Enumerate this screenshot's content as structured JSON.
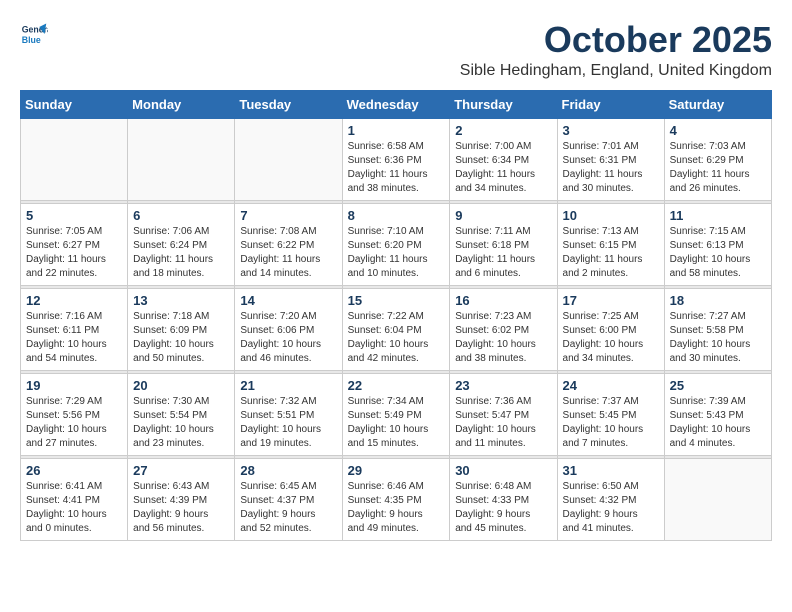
{
  "header": {
    "logo_line1": "General",
    "logo_line2": "Blue",
    "month_title": "October 2025",
    "location": "Sible Hedingham, England, United Kingdom"
  },
  "days_of_week": [
    "Sunday",
    "Monday",
    "Tuesday",
    "Wednesday",
    "Thursday",
    "Friday",
    "Saturday"
  ],
  "weeks": [
    [
      {
        "day": "",
        "info": ""
      },
      {
        "day": "",
        "info": ""
      },
      {
        "day": "",
        "info": ""
      },
      {
        "day": "1",
        "info": "Sunrise: 6:58 AM\nSunset: 6:36 PM\nDaylight: 11 hours\nand 38 minutes."
      },
      {
        "day": "2",
        "info": "Sunrise: 7:00 AM\nSunset: 6:34 PM\nDaylight: 11 hours\nand 34 minutes."
      },
      {
        "day": "3",
        "info": "Sunrise: 7:01 AM\nSunset: 6:31 PM\nDaylight: 11 hours\nand 30 minutes."
      },
      {
        "day": "4",
        "info": "Sunrise: 7:03 AM\nSunset: 6:29 PM\nDaylight: 11 hours\nand 26 minutes."
      }
    ],
    [
      {
        "day": "5",
        "info": "Sunrise: 7:05 AM\nSunset: 6:27 PM\nDaylight: 11 hours\nand 22 minutes."
      },
      {
        "day": "6",
        "info": "Sunrise: 7:06 AM\nSunset: 6:24 PM\nDaylight: 11 hours\nand 18 minutes."
      },
      {
        "day": "7",
        "info": "Sunrise: 7:08 AM\nSunset: 6:22 PM\nDaylight: 11 hours\nand 14 minutes."
      },
      {
        "day": "8",
        "info": "Sunrise: 7:10 AM\nSunset: 6:20 PM\nDaylight: 11 hours\nand 10 minutes."
      },
      {
        "day": "9",
        "info": "Sunrise: 7:11 AM\nSunset: 6:18 PM\nDaylight: 11 hours\nand 6 minutes."
      },
      {
        "day": "10",
        "info": "Sunrise: 7:13 AM\nSunset: 6:15 PM\nDaylight: 11 hours\nand 2 minutes."
      },
      {
        "day": "11",
        "info": "Sunrise: 7:15 AM\nSunset: 6:13 PM\nDaylight: 10 hours\nand 58 minutes."
      }
    ],
    [
      {
        "day": "12",
        "info": "Sunrise: 7:16 AM\nSunset: 6:11 PM\nDaylight: 10 hours\nand 54 minutes."
      },
      {
        "day": "13",
        "info": "Sunrise: 7:18 AM\nSunset: 6:09 PM\nDaylight: 10 hours\nand 50 minutes."
      },
      {
        "day": "14",
        "info": "Sunrise: 7:20 AM\nSunset: 6:06 PM\nDaylight: 10 hours\nand 46 minutes."
      },
      {
        "day": "15",
        "info": "Sunrise: 7:22 AM\nSunset: 6:04 PM\nDaylight: 10 hours\nand 42 minutes."
      },
      {
        "day": "16",
        "info": "Sunrise: 7:23 AM\nSunset: 6:02 PM\nDaylight: 10 hours\nand 38 minutes."
      },
      {
        "day": "17",
        "info": "Sunrise: 7:25 AM\nSunset: 6:00 PM\nDaylight: 10 hours\nand 34 minutes."
      },
      {
        "day": "18",
        "info": "Sunrise: 7:27 AM\nSunset: 5:58 PM\nDaylight: 10 hours\nand 30 minutes."
      }
    ],
    [
      {
        "day": "19",
        "info": "Sunrise: 7:29 AM\nSunset: 5:56 PM\nDaylight: 10 hours\nand 27 minutes."
      },
      {
        "day": "20",
        "info": "Sunrise: 7:30 AM\nSunset: 5:54 PM\nDaylight: 10 hours\nand 23 minutes."
      },
      {
        "day": "21",
        "info": "Sunrise: 7:32 AM\nSunset: 5:51 PM\nDaylight: 10 hours\nand 19 minutes."
      },
      {
        "day": "22",
        "info": "Sunrise: 7:34 AM\nSunset: 5:49 PM\nDaylight: 10 hours\nand 15 minutes."
      },
      {
        "day": "23",
        "info": "Sunrise: 7:36 AM\nSunset: 5:47 PM\nDaylight: 10 hours\nand 11 minutes."
      },
      {
        "day": "24",
        "info": "Sunrise: 7:37 AM\nSunset: 5:45 PM\nDaylight: 10 hours\nand 7 minutes."
      },
      {
        "day": "25",
        "info": "Sunrise: 7:39 AM\nSunset: 5:43 PM\nDaylight: 10 hours\nand 4 minutes."
      }
    ],
    [
      {
        "day": "26",
        "info": "Sunrise: 6:41 AM\nSunset: 4:41 PM\nDaylight: 10 hours\nand 0 minutes."
      },
      {
        "day": "27",
        "info": "Sunrise: 6:43 AM\nSunset: 4:39 PM\nDaylight: 9 hours\nand 56 minutes."
      },
      {
        "day": "28",
        "info": "Sunrise: 6:45 AM\nSunset: 4:37 PM\nDaylight: 9 hours\nand 52 minutes."
      },
      {
        "day": "29",
        "info": "Sunrise: 6:46 AM\nSunset: 4:35 PM\nDaylight: 9 hours\nand 49 minutes."
      },
      {
        "day": "30",
        "info": "Sunrise: 6:48 AM\nSunset: 4:33 PM\nDaylight: 9 hours\nand 45 minutes."
      },
      {
        "day": "31",
        "info": "Sunrise: 6:50 AM\nSunset: 4:32 PM\nDaylight: 9 hours\nand 41 minutes."
      },
      {
        "day": "",
        "info": ""
      }
    ]
  ]
}
